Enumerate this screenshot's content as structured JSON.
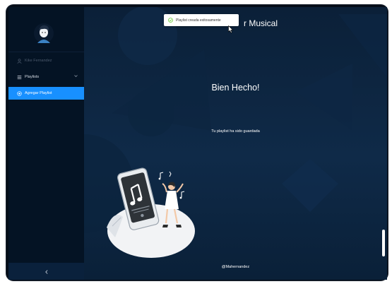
{
  "app": {
    "title_visible": "r Musical"
  },
  "toast": {
    "text": "Playlist creada exitosamente"
  },
  "sidebar": {
    "items": [
      {
        "label": "Kike Fernandez",
        "icon": "user-icon"
      },
      {
        "label": "Playlists",
        "icon": "list-icon"
      },
      {
        "label": "Agregar Playlist",
        "icon": "add-circle-icon"
      }
    ],
    "collapse_icon": "chevron-left-icon"
  },
  "main": {
    "heading": "Bien Hecho!",
    "message": "Tu playlist ha sido guardada",
    "footer": "@Mahernandez"
  },
  "colors": {
    "accent": "#1890ff",
    "success": "#52c41a",
    "sidebar_bg": "#041324",
    "main_bg": "#0f2a48"
  }
}
